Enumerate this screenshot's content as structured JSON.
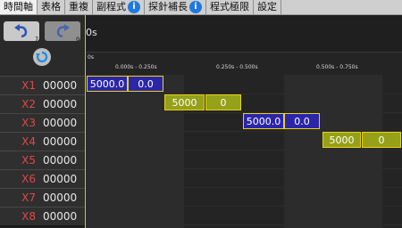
{
  "tabs": [
    {
      "label": "時間軸",
      "active": true,
      "info": false
    },
    {
      "label": "表格",
      "active": false,
      "info": false
    },
    {
      "label": "重複",
      "active": false,
      "info": false
    },
    {
      "label": "副程式",
      "active": false,
      "info": true
    },
    {
      "label": "探針補長",
      "active": false,
      "info": true
    },
    {
      "label": "程式極限",
      "active": false,
      "info": false
    },
    {
      "label": "設定",
      "active": false,
      "info": false
    }
  ],
  "toolbar": {
    "undo_sub": "7",
    "redo_sub": "0",
    "info_glyph": "i"
  },
  "timeline": {
    "current_time": "0s",
    "zero_label": "0s",
    "ranges": [
      "0.000s - 0.250s",
      "0.250s - 0.500s",
      "0.500s - 0.750s"
    ]
  },
  "channels": [
    {
      "name": "X1",
      "value": "00000"
    },
    {
      "name": "X2",
      "value": "00000"
    },
    {
      "name": "X3",
      "value": "00000"
    },
    {
      "name": "X4",
      "value": "00000"
    },
    {
      "name": "X5",
      "value": "00000"
    },
    {
      "name": "X6",
      "value": "00000"
    },
    {
      "name": "X7",
      "value": "00000"
    },
    {
      "name": "X8",
      "value": "00000"
    }
  ],
  "blocks": [
    {
      "row": 0,
      "slot": 0,
      "text": "5000.0",
      "color": "#2b26a8"
    },
    {
      "row": 0,
      "slot": 1,
      "text": "0.0",
      "color": "#2b26a8"
    },
    {
      "row": 1,
      "slot": 2,
      "text": "5000",
      "color": "#96a019"
    },
    {
      "row": 1,
      "slot": 3,
      "text": "0",
      "color": "#96a019"
    },
    {
      "row": 2,
      "slot": 4,
      "text": "5000.0",
      "color": "#2b26a8"
    },
    {
      "row": 2,
      "slot": 5,
      "text": "0.0",
      "color": "#2b26a8"
    },
    {
      "row": 3,
      "slot": 6,
      "text": "5000",
      "color": "#96a019"
    },
    {
      "row": 3,
      "slot": 7,
      "text": "0",
      "color": "#96a019"
    }
  ],
  "colors": {
    "accent_line": "#d6c419",
    "channel_name": "#e04848",
    "info": "#1e7ae0"
  }
}
